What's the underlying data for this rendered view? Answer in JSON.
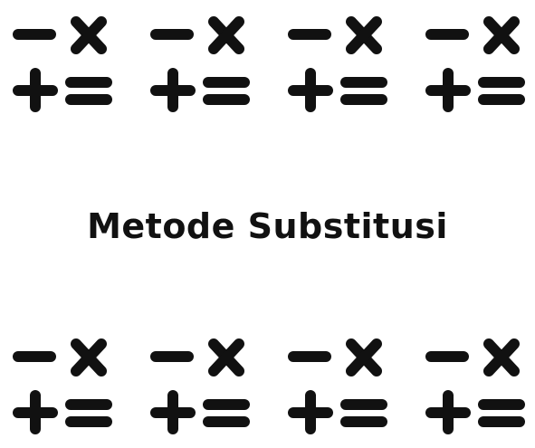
{
  "title": "Metode Substitusi",
  "colors": {
    "symbol": "#111111",
    "background": "#ffffff"
  },
  "icons": {
    "symbol_set": [
      "minus-icon",
      "times-icon",
      "plus-icon",
      "equals-icon"
    ],
    "top_row_count": 4,
    "bottom_row_count": 4
  }
}
